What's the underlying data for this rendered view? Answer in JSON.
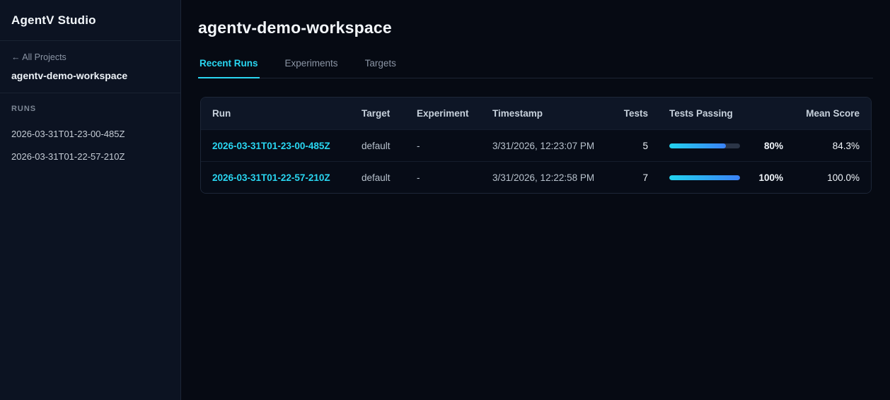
{
  "app": {
    "title": "AgentV Studio"
  },
  "sidebar": {
    "back_link": "← All Projects",
    "workspace_name": "agentv-demo-workspace",
    "runs_label": "RUNS",
    "runs": [
      "2026-03-31T01-23-00-485Z",
      "2026-03-31T01-22-57-210Z"
    ]
  },
  "main": {
    "title": "agentv-demo-workspace",
    "tabs": [
      {
        "label": "Recent Runs",
        "active": true
      },
      {
        "label": "Experiments",
        "active": false
      },
      {
        "label": "Targets",
        "active": false
      }
    ],
    "table": {
      "columns": [
        "Run",
        "Target",
        "Experiment",
        "Timestamp",
        "Tests",
        "Tests Passing",
        "Mean Score"
      ],
      "rows": [
        {
          "run": "2026-03-31T01-23-00-485Z",
          "target": "default",
          "experiment": "-",
          "timestamp": "3/31/2026, 12:23:07 PM",
          "tests": "5",
          "passing_value": 80,
          "passing_pct": "80%",
          "mean_score": "84.3%"
        },
        {
          "run": "2026-03-31T01-22-57-210Z",
          "target": "default",
          "experiment": "-",
          "timestamp": "3/31/2026, 12:22:58 PM",
          "tests": "7",
          "passing_value": 100,
          "passing_pct": "100%",
          "mean_score": "100.0%"
        }
      ]
    }
  },
  "colors": {
    "accent_cyan": "#22d3ee",
    "accent_blue": "#3b82f6",
    "sidebar_bg": "#0c1322",
    "main_bg": "#060a13"
  }
}
